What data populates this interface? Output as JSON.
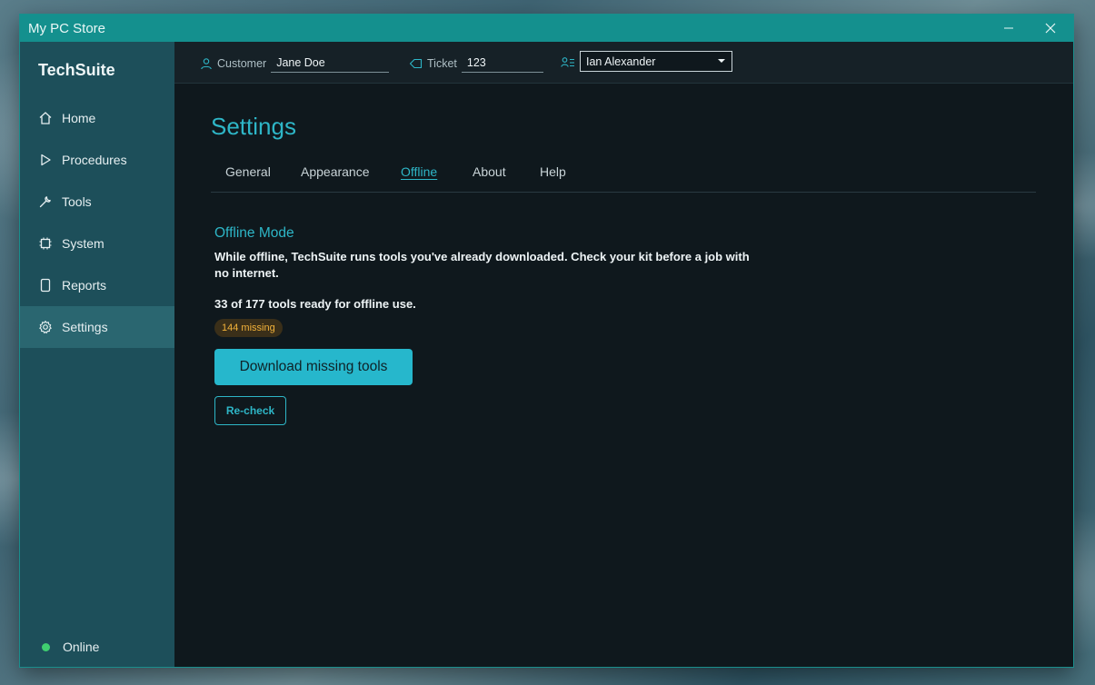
{
  "window": {
    "title": "My PC Store"
  },
  "sidebar": {
    "brand": "TechSuite",
    "items": [
      {
        "label": "Home",
        "icon": "home-icon",
        "active": false
      },
      {
        "label": "Procedures",
        "icon": "play-icon",
        "active": false
      },
      {
        "label": "Tools",
        "icon": "wrench-icon",
        "active": false
      },
      {
        "label": "System",
        "icon": "chip-icon",
        "active": false
      },
      {
        "label": "Reports",
        "icon": "document-icon",
        "active": false
      },
      {
        "label": "Settings",
        "icon": "gear-icon",
        "active": true
      }
    ],
    "status": {
      "label": "Online",
      "color": "#3fcf70"
    }
  },
  "topbar": {
    "customer": {
      "label": "Customer",
      "value": "Jane Doe"
    },
    "ticket": {
      "label": "Ticket",
      "value": "123"
    },
    "technician": {
      "selected": "Ian Alexander"
    }
  },
  "main": {
    "title": "Settings",
    "tabs": [
      {
        "label": "General",
        "active": false
      },
      {
        "label": "Appearance",
        "active": false
      },
      {
        "label": "Offline",
        "active": true
      },
      {
        "label": "About",
        "active": false
      },
      {
        "label": "Help",
        "active": false
      }
    ],
    "offline": {
      "section_title": "Offline Mode",
      "description": "While offline, TechSuite runs tools you've already downloaded. Check your kit before a job with no internet.",
      "count_text": "33 of 177 tools ready for offline use.",
      "missing_badge": "144 missing",
      "download_button": "Download missing tools",
      "recheck_button": "Re-check"
    }
  },
  "colors": {
    "accent": "#2eb6c7",
    "titlebar": "#14908e",
    "sidebar": "#1d4f5a",
    "warning": "#f2b23a"
  }
}
